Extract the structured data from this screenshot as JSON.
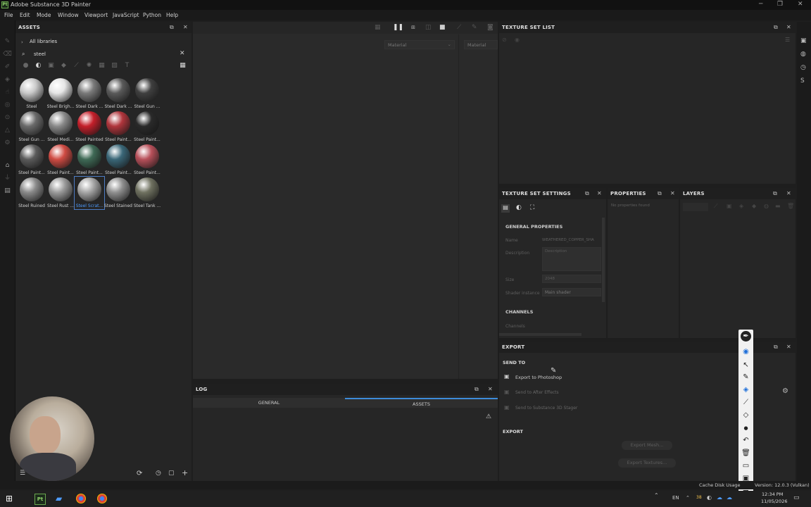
{
  "app": {
    "title": "Adobe Substance 3D Painter",
    "logo_text": "Pt"
  },
  "menu": [
    "File",
    "Edit",
    "Mode",
    "Window",
    "Viewport",
    "JavaScript",
    "Python",
    "Help"
  ],
  "assets": {
    "title": "ASSETS",
    "library": "All libraries",
    "search_value": "steel",
    "materials": [
      {
        "label": "Steel",
        "color": "#c9c9c9"
      },
      {
        "label": "Steel Brigh...",
        "color": "#e6e6e6"
      },
      {
        "label": "Steel Dark ...",
        "color": "#7a7a7a"
      },
      {
        "label": "Steel Dark ...",
        "color": "#5a5a5a"
      },
      {
        "label": "Steel Gun ...",
        "color": "#3f3f3f"
      },
      {
        "label": "Steel Gun ...",
        "color": "#6a6a6a"
      },
      {
        "label": "Steel Medi...",
        "color": "#8a8a8a"
      },
      {
        "label": "Steel Painted",
        "color": "#c41f2a"
      },
      {
        "label": "Steel Paint...",
        "color": "#b0353c"
      },
      {
        "label": "Steel Paint...",
        "color": "#2a2a2a"
      },
      {
        "label": "Steel Paint...",
        "color": "#5b5b5b"
      },
      {
        "label": "Steel Paint...",
        "color": "#d04b43"
      },
      {
        "label": "Steel Paint...",
        "color": "#3f6a56"
      },
      {
        "label": "Steel Paint...",
        "color": "#3a6778"
      },
      {
        "label": "Steel Paint...",
        "color": "#b8505a"
      },
      {
        "label": "Steel Ruined",
        "color": "#8a8a8a"
      },
      {
        "label": "Steel Rust ...",
        "color": "#9b9b9b"
      },
      {
        "label": "Steel Scrat...",
        "color": "#a6a6a6",
        "selected": true
      },
      {
        "label": "Steel Stained",
        "color": "#8f8f8f"
      },
      {
        "label": "Steel Tank ...",
        "color": "#6f7160"
      }
    ]
  },
  "viewport": {
    "material_left": "Material",
    "material_right": "Material"
  },
  "log": {
    "title": "LOG",
    "tabs": [
      "GENERAL",
      "ASSETS"
    ]
  },
  "texture_set_list": {
    "title": "TEXTURE SET LIST"
  },
  "texture_set_settings": {
    "title": "TEXTURE SET SETTINGS",
    "general_properties": "GENERAL PROPERTIES",
    "name_label": "Name",
    "name_value": "WEATHERED_COPPER_SHA",
    "description_label": "Description",
    "description_placeholder": "Description",
    "size_label": "Size",
    "size_value": "2048",
    "shader_label": "Shader instance",
    "shader_value": "Main shader",
    "channels_heading": "CHANNELS",
    "channels_label": "Channels"
  },
  "properties": {
    "title": "PROPERTIES",
    "empty_text": "No properties found"
  },
  "layers": {
    "title": "LAYERS"
  },
  "export": {
    "title": "EXPORT",
    "send_to": "SEND TO",
    "targets": [
      "Export to Photoshop",
      "Send to After Effects",
      "Send to Substance 3D Stager"
    ],
    "export_heading": "EXPORT",
    "export_mesh": "Export Mesh...",
    "export_textures": "Export Textures..."
  },
  "status": {
    "cache": "Cache Disk Usage",
    "version": "Version: 12.0.3 (Vulkan)"
  },
  "taskbar": {
    "lang": "EN",
    "time": "12:34 PM",
    "date": "11/05/2026",
    "battery": "38"
  }
}
